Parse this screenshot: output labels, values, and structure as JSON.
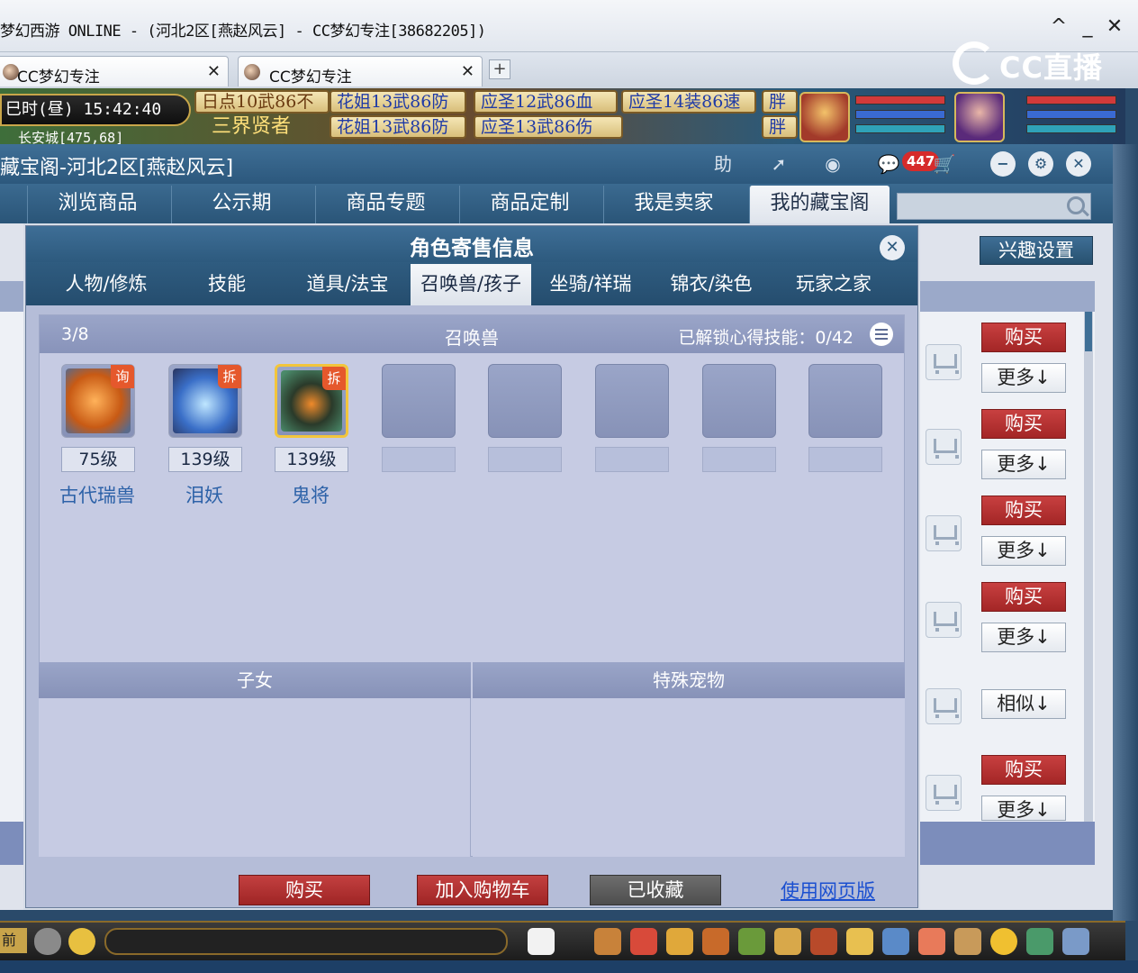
{
  "window": {
    "title": "梦幻西游 ONLINE - (河北2区[燕赵风云] - CC梦幻专注[38682205])",
    "controls": {
      "caret": "^",
      "minimize": "_",
      "close": "✕"
    }
  },
  "browser_tabs": [
    {
      "label": "CC梦幻专注",
      "close": "✕"
    },
    {
      "label": "CC梦幻专注",
      "close": "✕"
    }
  ],
  "new_tab": "+",
  "cc_logo": {
    "text": "CC直播",
    "icon": "cc-logo-icon"
  },
  "game_hud": {
    "clock": "巳时(昼) 15:42:40",
    "location": "长安城[475,68]",
    "npc_label": "三界贤者",
    "stall_banners": [
      "日点10武86不",
      "花姐13武86防",
      "应圣12武86血",
      "应圣14装86速",
      "胖",
      "花姐13武86防",
      "应圣13武86伤",
      "胖"
    ]
  },
  "cbg": {
    "title": "藏宝阁-河北2区[燕赵风云]",
    "header_icons": {
      "help": "助",
      "share": "share-icon",
      "record": "record-icon",
      "message": "message-icon",
      "message_count": "447",
      "cart": "cart-icon",
      "minimize": "−",
      "settings": "⚙",
      "close": "✕"
    },
    "nav_tabs": [
      "浏览商品",
      "公示期",
      "商品专题",
      "商品定制",
      "我是卖家",
      "我的藏宝阁"
    ],
    "active_nav": "我的藏宝阁",
    "search_placeholder": "",
    "interest_button": "兴趣设置",
    "list_actions": [
      {
        "primary": "购买",
        "secondary": "更多↓"
      },
      {
        "primary": "购买",
        "secondary": "更多↓"
      },
      {
        "primary": "购买",
        "secondary": "更多↓"
      },
      {
        "primary": "购买",
        "secondary": "更多↓"
      },
      {
        "primary": "",
        "secondary": "相似↓"
      },
      {
        "primary": "购买",
        "secondary": "更多↓"
      }
    ]
  },
  "modal": {
    "title": "角色寄售信息",
    "close": "✕",
    "tabs": [
      "人物/修炼",
      "技能",
      "道具/法宝",
      "召唤兽/孩子",
      "坐骑/祥瑞",
      "锦衣/染色",
      "玩家之家"
    ],
    "active_tab": "召唤兽/孩子",
    "pets_section": {
      "count": "3/8",
      "title": "召唤兽",
      "skill_unlock": "已解锁心得技能：0/42",
      "pets": [
        {
          "level": "75级",
          "name": "古代瑞兽",
          "tag": "询"
        },
        {
          "level": "139级",
          "name": "泪妖",
          "tag": "拆"
        },
        {
          "level": "139级",
          "name": "鬼将",
          "tag": "拆",
          "selected": true
        }
      ],
      "empty_slots": 5
    },
    "children_header": "子女",
    "special_pets_header": "特殊宠物",
    "buttons": {
      "buy": "购买",
      "add_to_cart": "加入购物车",
      "favorited": "已收藏",
      "web_version": "使用网页版"
    }
  },
  "bottom_bar": {
    "left_label": "前"
  }
}
